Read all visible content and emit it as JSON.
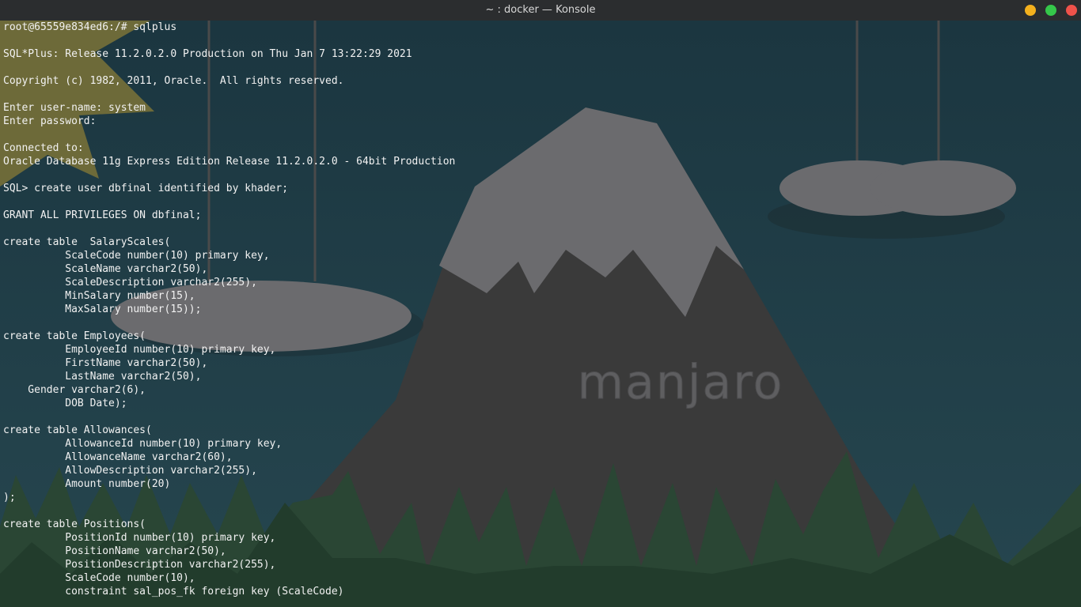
{
  "window": {
    "title": "~ : docker — Konsole"
  },
  "wallpaper": {
    "logo_text": "manjaro"
  },
  "terminal": {
    "lines": [
      "root@65559e834ed6:/# sqlplus",
      "",
      "SQL*Plus: Release 11.2.0.2.0 Production on Thu Jan 7 13:22:29 2021",
      "",
      "Copyright (c) 1982, 2011, Oracle.  All rights reserved.",
      "",
      "Enter user-name: system",
      "Enter password:",
      "",
      "Connected to:",
      "Oracle Database 11g Express Edition Release 11.2.0.2.0 - 64bit Production",
      "",
      "SQL> create user dbfinal identified by khader;",
      "",
      "GRANT ALL PRIVILEGES ON dbfinal;",
      "",
      "create table  SalaryScales(",
      "          ScaleCode number(10) primary key,",
      "          ScaleName varchar2(50),",
      "          ScaleDescription varchar2(255),",
      "          MinSalary number(15),",
      "          MaxSalary number(15));",
      "",
      "create table Employees(",
      "          EmployeeId number(10) primary key,",
      "          FirstName varchar2(50),",
      "          LastName varchar2(50),",
      "    Gender varchar2(6),",
      "          DOB Date);",
      "",
      "create table Allowances(",
      "          AllowanceId number(10) primary key,",
      "          AllowanceName varchar2(60),",
      "          AllowDescription varchar2(255),",
      "          Amount number(20)",
      ");",
      "",
      "create table Positions(",
      "          PositionId number(10) primary key,",
      "          PositionName varchar2(50),",
      "          PositionDescription varchar2(255),",
      "          ScaleCode number(10),",
      "          constraint sal_pos_fk foreign key (ScaleCode)"
    ]
  }
}
